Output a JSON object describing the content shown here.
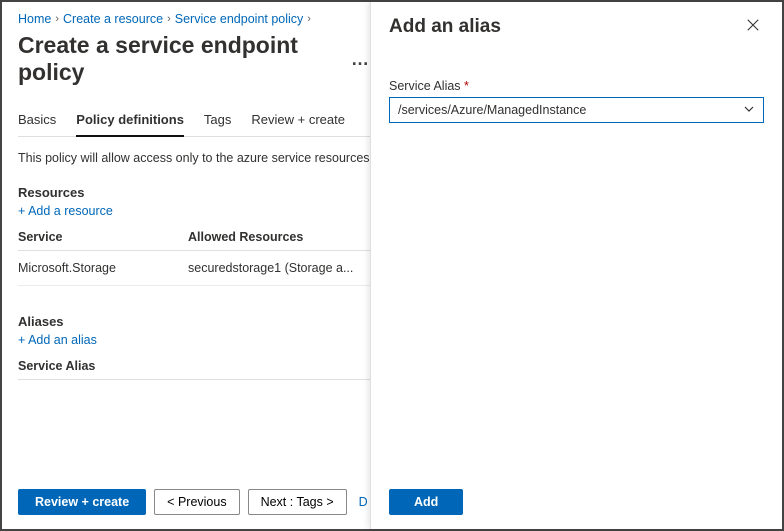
{
  "breadcrumb": {
    "items": [
      {
        "label": "Home"
      },
      {
        "label": "Create a resource"
      },
      {
        "label": "Service endpoint policy"
      }
    ]
  },
  "page": {
    "title": "Create a service endpoint policy",
    "more": "…"
  },
  "tabs": {
    "items": [
      {
        "label": "Basics",
        "active": false
      },
      {
        "label": "Policy definitions",
        "active": true
      },
      {
        "label": "Tags",
        "active": false
      },
      {
        "label": "Review + create",
        "active": false
      }
    ]
  },
  "desc": "This policy will allow access only to the azure service resources list",
  "resources": {
    "heading": "Resources",
    "add_label": "+ Add a resource",
    "cols": {
      "service": "Service",
      "allowed": "Allowed Resources"
    },
    "rows": [
      {
        "service": "Microsoft.Storage",
        "allowed": "securedstorage1 (Storage a..."
      }
    ]
  },
  "aliases": {
    "heading": "Aliases",
    "add_label": "+ Add an alias",
    "col": "Service Alias"
  },
  "footer": {
    "review": "Review + create",
    "prev": "< Previous",
    "next": "Next : Tags >",
    "cutoff": "D"
  },
  "panel": {
    "title": "Add an alias",
    "field_label": "Service Alias",
    "required": "*",
    "value": "/services/Azure/ManagedInstance",
    "add": "Add"
  }
}
